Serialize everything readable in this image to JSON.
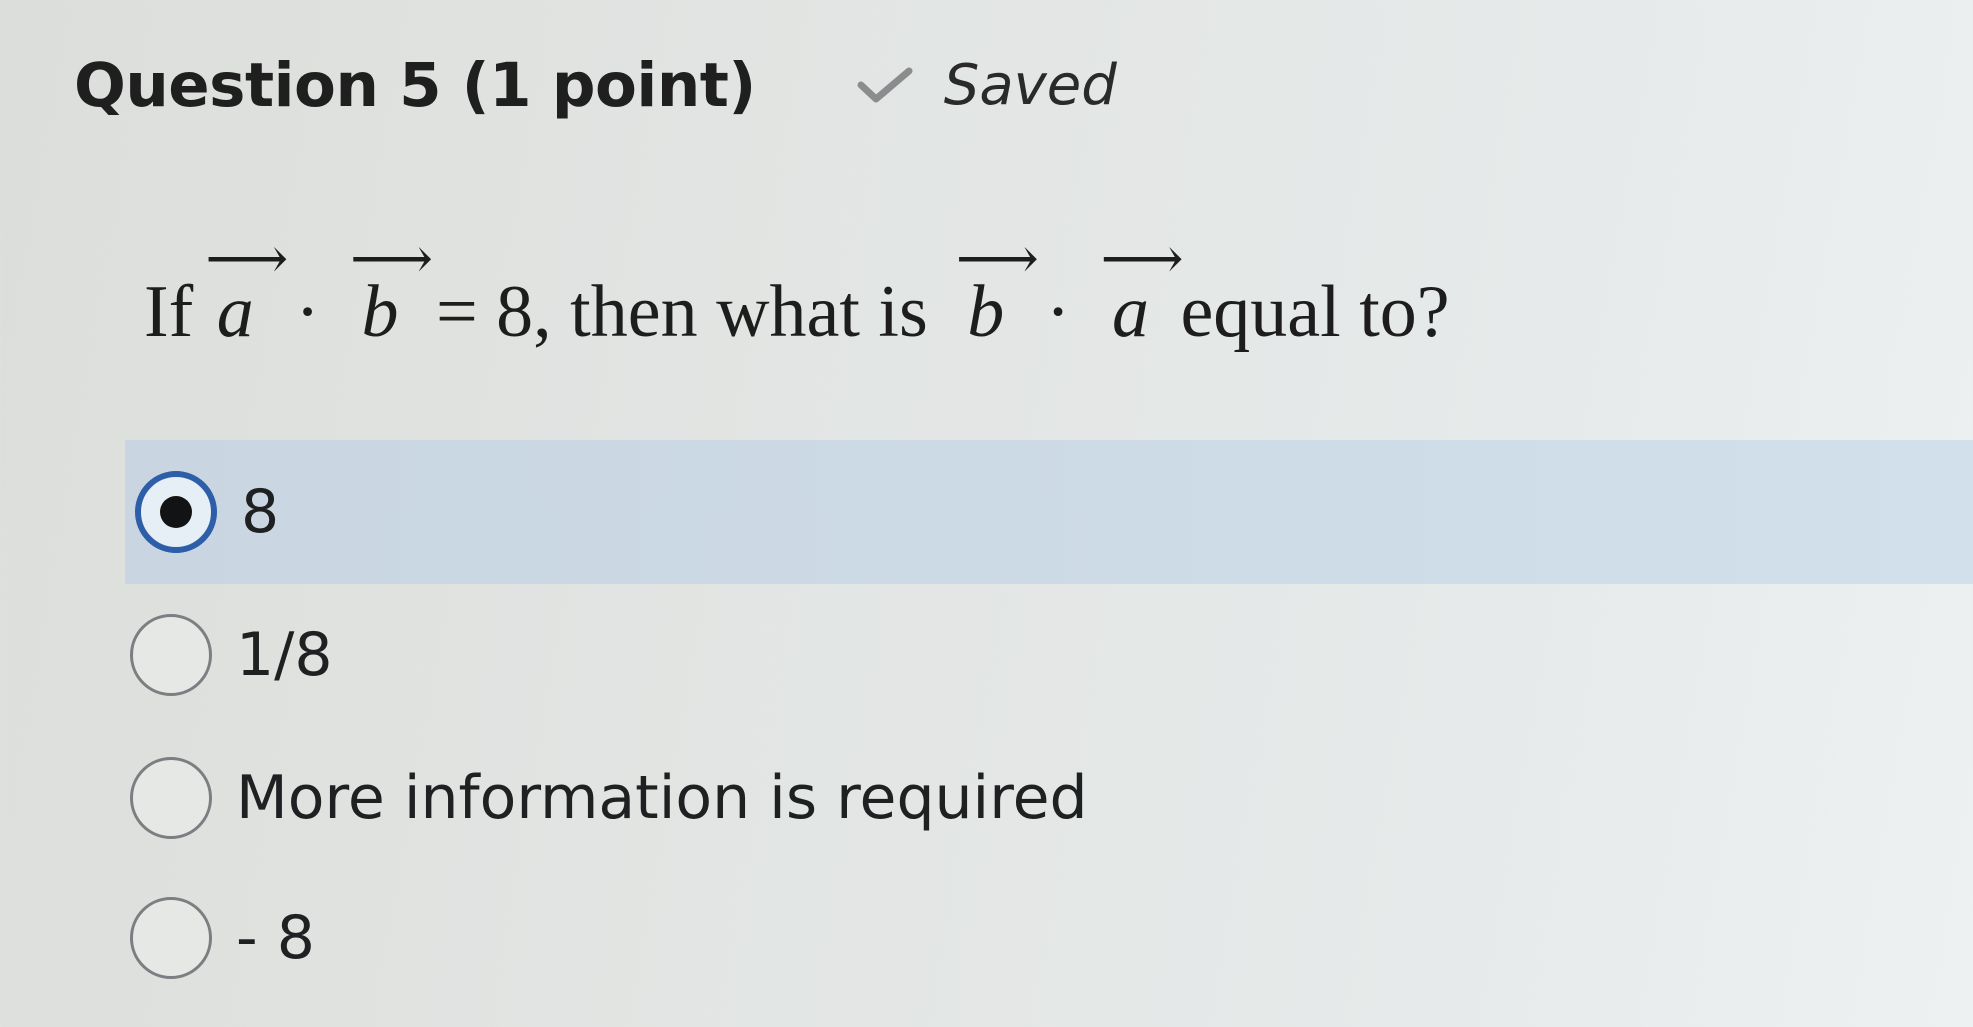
{
  "question": {
    "title": "Question 5 (1 point)",
    "status": "Saved",
    "status_icon": "check-icon",
    "prompt": {
      "if": "If",
      "vec1": "a",
      "dot": "·",
      "vec2": "b",
      "equals": "= 8, then what is",
      "vec3": "b",
      "dot2": "·",
      "vec4": "a",
      "suffix": "equal to?"
    }
  },
  "options": [
    {
      "label": "8",
      "selected": true
    },
    {
      "label": "1/8",
      "selected": false
    },
    {
      "label": "More information is required",
      "selected": false
    },
    {
      "label": "- 8",
      "selected": false
    }
  ],
  "colors": {
    "selected_row": "#cddbe7",
    "radio_selected_border": "#2d5ea8",
    "radio_border": "#7c7f82",
    "check": "#8a8c8e"
  }
}
